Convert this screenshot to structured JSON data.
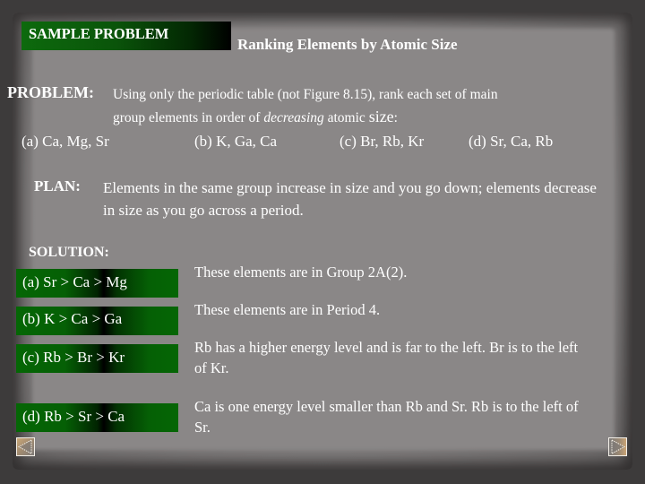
{
  "header": {
    "sample_label": "SAMPLE PROBLEM",
    "title": "Ranking Elements by Atomic Size"
  },
  "problem": {
    "label": "PROBLEM:",
    "line1": "Using only the periodic table (not Figure 8.15), rank each set of main",
    "line2_pre": "group elements in order of ",
    "line2_em": "decreasing",
    "line2_mid": " atomic ",
    "line2_size": "size",
    "line2_end": ":",
    "parts": [
      {
        "label": "(a) Ca, Mg, Sr"
      },
      {
        "label": "(b) K, Ga, Ca"
      },
      {
        "label": "(c) Br, Rb, Kr"
      },
      {
        "label": "(d) Sr, Ca, Rb"
      }
    ]
  },
  "plan": {
    "label": "PLAN:",
    "text": "Elements in the same group increase in size and you go down;  elements decrease in size as you go across a period."
  },
  "solution": {
    "label": "SOLUTION:",
    "answers": [
      {
        "answer": "(a) Sr > Ca > Mg",
        "explanation": "These elements are in Group 2A(2)."
      },
      {
        "answer": "(b) K > Ca > Ga",
        "explanation": "These elements are in Period 4."
      },
      {
        "answer": "(c) Rb > Br > Kr",
        "explanation": "Rb has a higher energy level and is far to the left.  Br is to the left of Kr."
      },
      {
        "answer": "(d) Rb > Sr > Ca",
        "explanation": "Ca is one energy level smaller than Rb and Sr. Rb is to the left of Sr."
      }
    ]
  },
  "navigation": {
    "prev_icon": "triangle-left-icon",
    "next_icon": "triangle-right-icon"
  },
  "colors": {
    "accent_green": "#0d6a0d",
    "background": "#3d3b3b",
    "paper": "#8a8787",
    "text": "#ffffff"
  }
}
